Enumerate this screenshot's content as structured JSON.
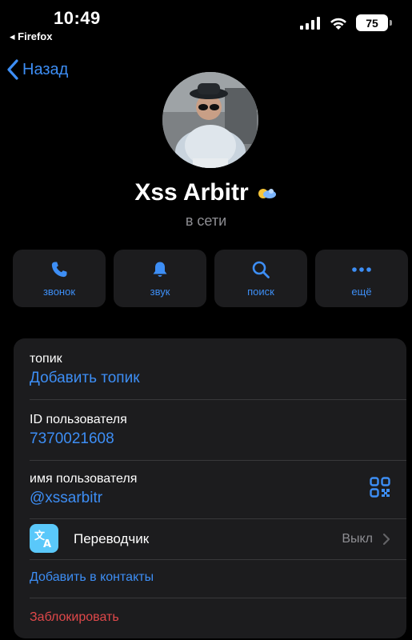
{
  "status": {
    "time": "10:49",
    "return_app": "◂ Firefox",
    "battery": "75"
  },
  "nav": {
    "back_label": "Назад"
  },
  "profile": {
    "name": "Xss Arbitr",
    "presence": "в сети"
  },
  "actions": [
    {
      "label": "звонок",
      "icon": "phone-icon"
    },
    {
      "label": "звук",
      "icon": "bell-icon"
    },
    {
      "label": "поиск",
      "icon": "search-icon"
    },
    {
      "label": "ещё",
      "icon": "more-icon"
    }
  ],
  "info": {
    "topic_label": "топик",
    "topic_value": "Добавить топик",
    "user_id_label": "ID пользователя",
    "user_id_value": "7370021608",
    "username_label": "имя пользователя",
    "username_value": "@xssarbitr",
    "translator_label": "Переводчик",
    "translator_value": "Выкл",
    "add_contact": "Добавить в контакты",
    "block": "Заблокировать"
  },
  "colors": {
    "accent": "#3d8ef5",
    "danger": "#e0484a",
    "card": "#1c1c1e",
    "muted": "#8e8e93"
  }
}
